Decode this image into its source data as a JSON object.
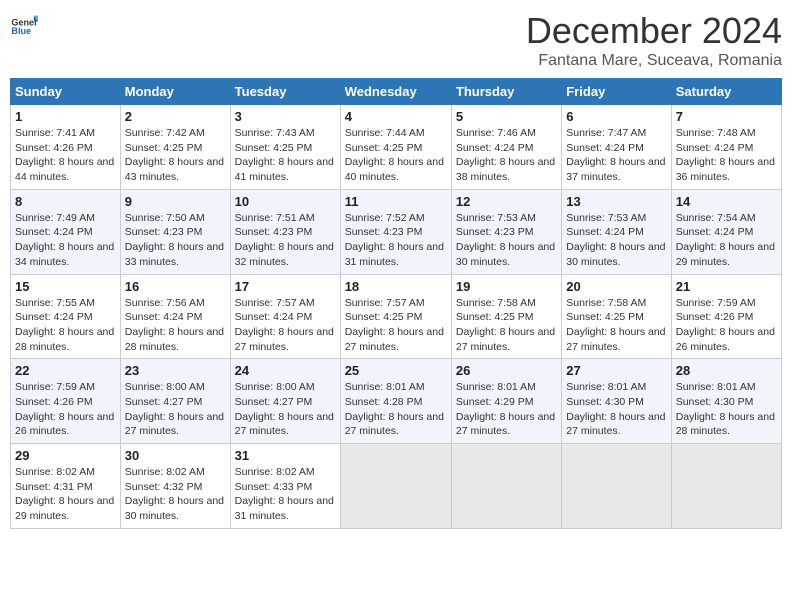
{
  "header": {
    "logo_general": "General",
    "logo_blue": "Blue",
    "month_title": "December 2024",
    "location": "Fantana Mare, Suceava, Romania"
  },
  "days_of_week": [
    "Sunday",
    "Monday",
    "Tuesday",
    "Wednesday",
    "Thursday",
    "Friday",
    "Saturday"
  ],
  "weeks": [
    [
      {
        "day": "1",
        "sunrise": "Sunrise: 7:41 AM",
        "sunset": "Sunset: 4:26 PM",
        "daylight": "Daylight: 8 hours and 44 minutes."
      },
      {
        "day": "2",
        "sunrise": "Sunrise: 7:42 AM",
        "sunset": "Sunset: 4:25 PM",
        "daylight": "Daylight: 8 hours and 43 minutes."
      },
      {
        "day": "3",
        "sunrise": "Sunrise: 7:43 AM",
        "sunset": "Sunset: 4:25 PM",
        "daylight": "Daylight: 8 hours and 41 minutes."
      },
      {
        "day": "4",
        "sunrise": "Sunrise: 7:44 AM",
        "sunset": "Sunset: 4:25 PM",
        "daylight": "Daylight: 8 hours and 40 minutes."
      },
      {
        "day": "5",
        "sunrise": "Sunrise: 7:46 AM",
        "sunset": "Sunset: 4:24 PM",
        "daylight": "Daylight: 8 hours and 38 minutes."
      },
      {
        "day": "6",
        "sunrise": "Sunrise: 7:47 AM",
        "sunset": "Sunset: 4:24 PM",
        "daylight": "Daylight: 8 hours and 37 minutes."
      },
      {
        "day": "7",
        "sunrise": "Sunrise: 7:48 AM",
        "sunset": "Sunset: 4:24 PM",
        "daylight": "Daylight: 8 hours and 36 minutes."
      }
    ],
    [
      {
        "day": "8",
        "sunrise": "Sunrise: 7:49 AM",
        "sunset": "Sunset: 4:24 PM",
        "daylight": "Daylight: 8 hours and 34 minutes."
      },
      {
        "day": "9",
        "sunrise": "Sunrise: 7:50 AM",
        "sunset": "Sunset: 4:23 PM",
        "daylight": "Daylight: 8 hours and 33 minutes."
      },
      {
        "day": "10",
        "sunrise": "Sunrise: 7:51 AM",
        "sunset": "Sunset: 4:23 PM",
        "daylight": "Daylight: 8 hours and 32 minutes."
      },
      {
        "day": "11",
        "sunrise": "Sunrise: 7:52 AM",
        "sunset": "Sunset: 4:23 PM",
        "daylight": "Daylight: 8 hours and 31 minutes."
      },
      {
        "day": "12",
        "sunrise": "Sunrise: 7:53 AM",
        "sunset": "Sunset: 4:23 PM",
        "daylight": "Daylight: 8 hours and 30 minutes."
      },
      {
        "day": "13",
        "sunrise": "Sunrise: 7:53 AM",
        "sunset": "Sunset: 4:24 PM",
        "daylight": "Daylight: 8 hours and 30 minutes."
      },
      {
        "day": "14",
        "sunrise": "Sunrise: 7:54 AM",
        "sunset": "Sunset: 4:24 PM",
        "daylight": "Daylight: 8 hours and 29 minutes."
      }
    ],
    [
      {
        "day": "15",
        "sunrise": "Sunrise: 7:55 AM",
        "sunset": "Sunset: 4:24 PM",
        "daylight": "Daylight: 8 hours and 28 minutes."
      },
      {
        "day": "16",
        "sunrise": "Sunrise: 7:56 AM",
        "sunset": "Sunset: 4:24 PM",
        "daylight": "Daylight: 8 hours and 28 minutes."
      },
      {
        "day": "17",
        "sunrise": "Sunrise: 7:57 AM",
        "sunset": "Sunset: 4:24 PM",
        "daylight": "Daylight: 8 hours and 27 minutes."
      },
      {
        "day": "18",
        "sunrise": "Sunrise: 7:57 AM",
        "sunset": "Sunset: 4:25 PM",
        "daylight": "Daylight: 8 hours and 27 minutes."
      },
      {
        "day": "19",
        "sunrise": "Sunrise: 7:58 AM",
        "sunset": "Sunset: 4:25 PM",
        "daylight": "Daylight: 8 hours and 27 minutes."
      },
      {
        "day": "20",
        "sunrise": "Sunrise: 7:58 AM",
        "sunset": "Sunset: 4:25 PM",
        "daylight": "Daylight: 8 hours and 27 minutes."
      },
      {
        "day": "21",
        "sunrise": "Sunrise: 7:59 AM",
        "sunset": "Sunset: 4:26 PM",
        "daylight": "Daylight: 8 hours and 26 minutes."
      }
    ],
    [
      {
        "day": "22",
        "sunrise": "Sunrise: 7:59 AM",
        "sunset": "Sunset: 4:26 PM",
        "daylight": "Daylight: 8 hours and 26 minutes."
      },
      {
        "day": "23",
        "sunrise": "Sunrise: 8:00 AM",
        "sunset": "Sunset: 4:27 PM",
        "daylight": "Daylight: 8 hours and 27 minutes."
      },
      {
        "day": "24",
        "sunrise": "Sunrise: 8:00 AM",
        "sunset": "Sunset: 4:27 PM",
        "daylight": "Daylight: 8 hours and 27 minutes."
      },
      {
        "day": "25",
        "sunrise": "Sunrise: 8:01 AM",
        "sunset": "Sunset: 4:28 PM",
        "daylight": "Daylight: 8 hours and 27 minutes."
      },
      {
        "day": "26",
        "sunrise": "Sunrise: 8:01 AM",
        "sunset": "Sunset: 4:29 PM",
        "daylight": "Daylight: 8 hours and 27 minutes."
      },
      {
        "day": "27",
        "sunrise": "Sunrise: 8:01 AM",
        "sunset": "Sunset: 4:30 PM",
        "daylight": "Daylight: 8 hours and 27 minutes."
      },
      {
        "day": "28",
        "sunrise": "Sunrise: 8:01 AM",
        "sunset": "Sunset: 4:30 PM",
        "daylight": "Daylight: 8 hours and 28 minutes."
      }
    ],
    [
      {
        "day": "29",
        "sunrise": "Sunrise: 8:02 AM",
        "sunset": "Sunset: 4:31 PM",
        "daylight": "Daylight: 8 hours and 29 minutes."
      },
      {
        "day": "30",
        "sunrise": "Sunrise: 8:02 AM",
        "sunset": "Sunset: 4:32 PM",
        "daylight": "Daylight: 8 hours and 30 minutes."
      },
      {
        "day": "31",
        "sunrise": "Sunrise: 8:02 AM",
        "sunset": "Sunset: 4:33 PM",
        "daylight": "Daylight: 8 hours and 31 minutes."
      },
      null,
      null,
      null,
      null
    ]
  ]
}
